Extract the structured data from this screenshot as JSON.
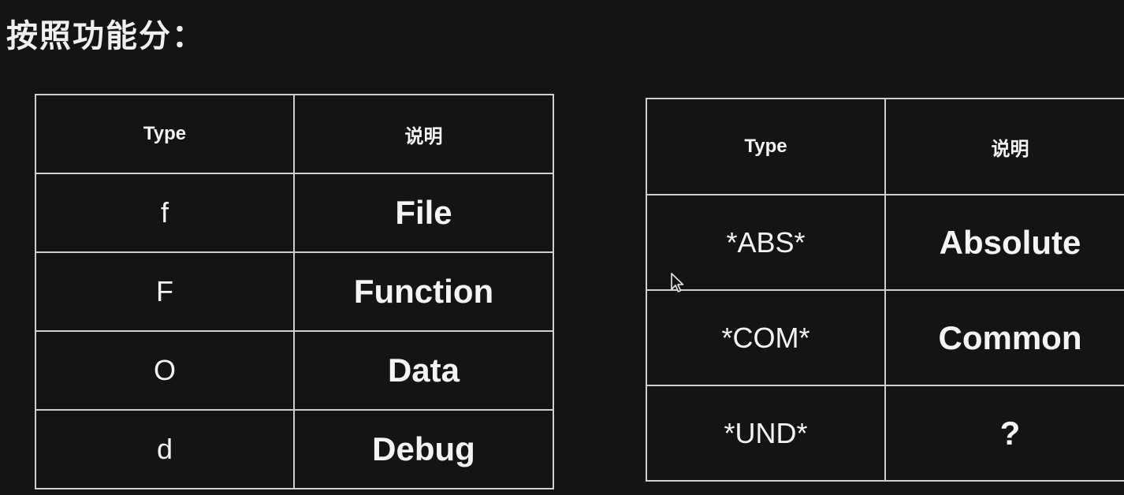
{
  "heading": "按照功能分：",
  "left_table": {
    "headers": {
      "type": "Type",
      "description": "说明"
    },
    "rows": [
      {
        "type": "f",
        "description": "File"
      },
      {
        "type": "F",
        "description": "Function"
      },
      {
        "type": "O",
        "description": "Data"
      },
      {
        "type": "d",
        "description": "Debug"
      }
    ]
  },
  "right_table": {
    "headers": {
      "type": "Type",
      "description": "说明"
    },
    "rows": [
      {
        "type": "*ABS*",
        "description": "Absolute"
      },
      {
        "type": "*COM*",
        "description": "Common"
      },
      {
        "type": "*UND*",
        "description": "?"
      }
    ]
  },
  "colors": {
    "background": "#141414",
    "text": "#f4f4f4",
    "border": "#cfcfcf"
  },
  "icons": {
    "cursor": "mouse-pointer-icon"
  }
}
